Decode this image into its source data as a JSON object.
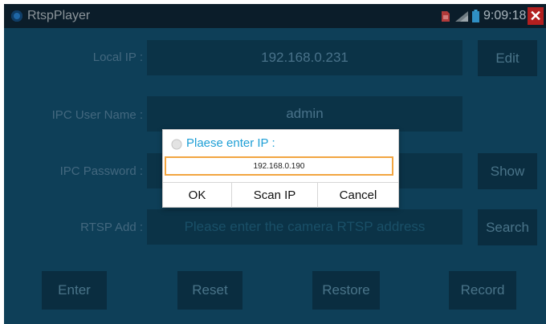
{
  "statusbar": {
    "app_title": "RtspPlayer",
    "time": "9:09:18",
    "close_glyph": "✕",
    "icons": [
      "app-icon",
      "sim-icon",
      "signal-icon",
      "battery-icon"
    ]
  },
  "form": {
    "local_ip_label": "Local IP :",
    "local_ip_value": "192.168.0.231",
    "user_label": "IPC User Name :",
    "user_value": "admin",
    "password_label": "IPC Password :",
    "password_value": "",
    "rtsp_label": "RTSP Add :",
    "rtsp_placeholder": "Please enter the camera RTSP address"
  },
  "buttons": {
    "edit": "Edit",
    "show": "Show",
    "search": "Search",
    "enter": "Enter",
    "reset": "Reset",
    "restore": "Restore",
    "record": "Record"
  },
  "dialog": {
    "title": "Plaese enter IP :",
    "input_value": "192.168.0.190",
    "ok": "OK",
    "scan": "Scan IP",
    "cancel": "Cancel"
  },
  "colors": {
    "screen_bg": "#0e3f58",
    "dialog_title": "#1e9fd6",
    "input_focus": "#f2a541",
    "close_bg": "#b21f1f"
  }
}
